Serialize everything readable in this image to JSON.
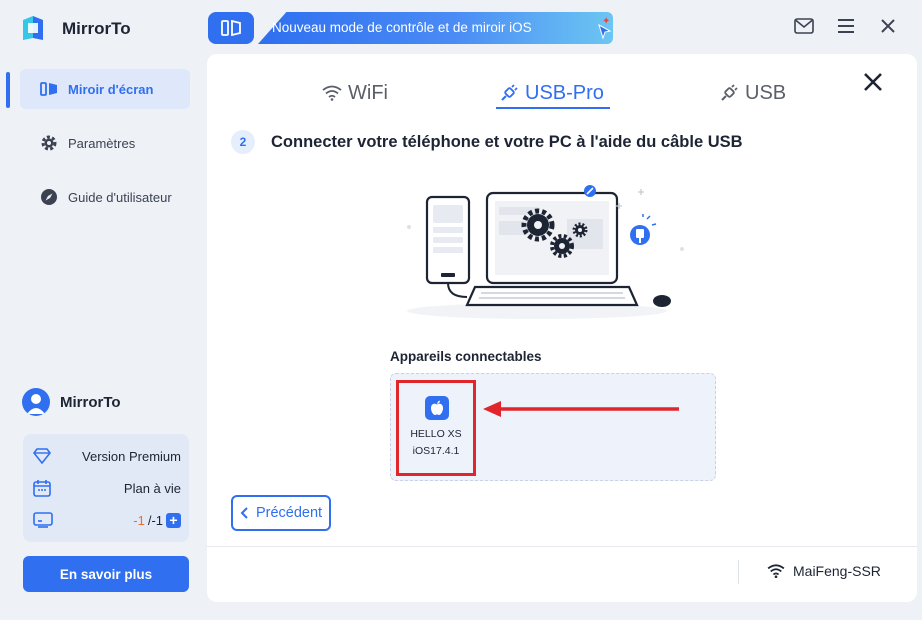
{
  "app": {
    "name": "MirrorTo",
    "accent": "#2f6ff0"
  },
  "banner": {
    "text": "Nouveau mode de contrôle et de miroir iOS"
  },
  "sidebar": {
    "items": [
      {
        "label": "Miroir d'écran",
        "icon": "screen-mirror-icon",
        "active": true
      },
      {
        "label": "Paramètres",
        "icon": "gear-icon",
        "active": false
      },
      {
        "label": "Guide d'utilisateur",
        "icon": "compass-icon",
        "active": false
      }
    ],
    "user": {
      "name": "MirrorTo"
    },
    "plan": {
      "version_label": "Version Premium",
      "duration_label": "Plan à vie",
      "count_used": "-1",
      "count_total": "/-1",
      "add_label": "+"
    },
    "learn_more": "En savoir plus"
  },
  "main": {
    "tabs": [
      {
        "label": "WiFi",
        "icon": "wifi-icon",
        "active": false
      },
      {
        "label": "USB-Pro",
        "icon": "usb-plug-icon",
        "active": true
      },
      {
        "label": "USB",
        "icon": "usb-plug-icon",
        "active": false
      }
    ],
    "step": {
      "number": "2",
      "title": "Connecter votre téléphone et votre PC à l'aide du câble USB"
    },
    "devices_label": "Appareils connectables",
    "devices": [
      {
        "name": "HELLO XS",
        "os": "iOS17.4.1",
        "icon": "apple-icon"
      }
    ],
    "previous_label": "Précédent",
    "network": {
      "name": "MaiFeng-SSR",
      "icon": "wifi-icon"
    }
  }
}
